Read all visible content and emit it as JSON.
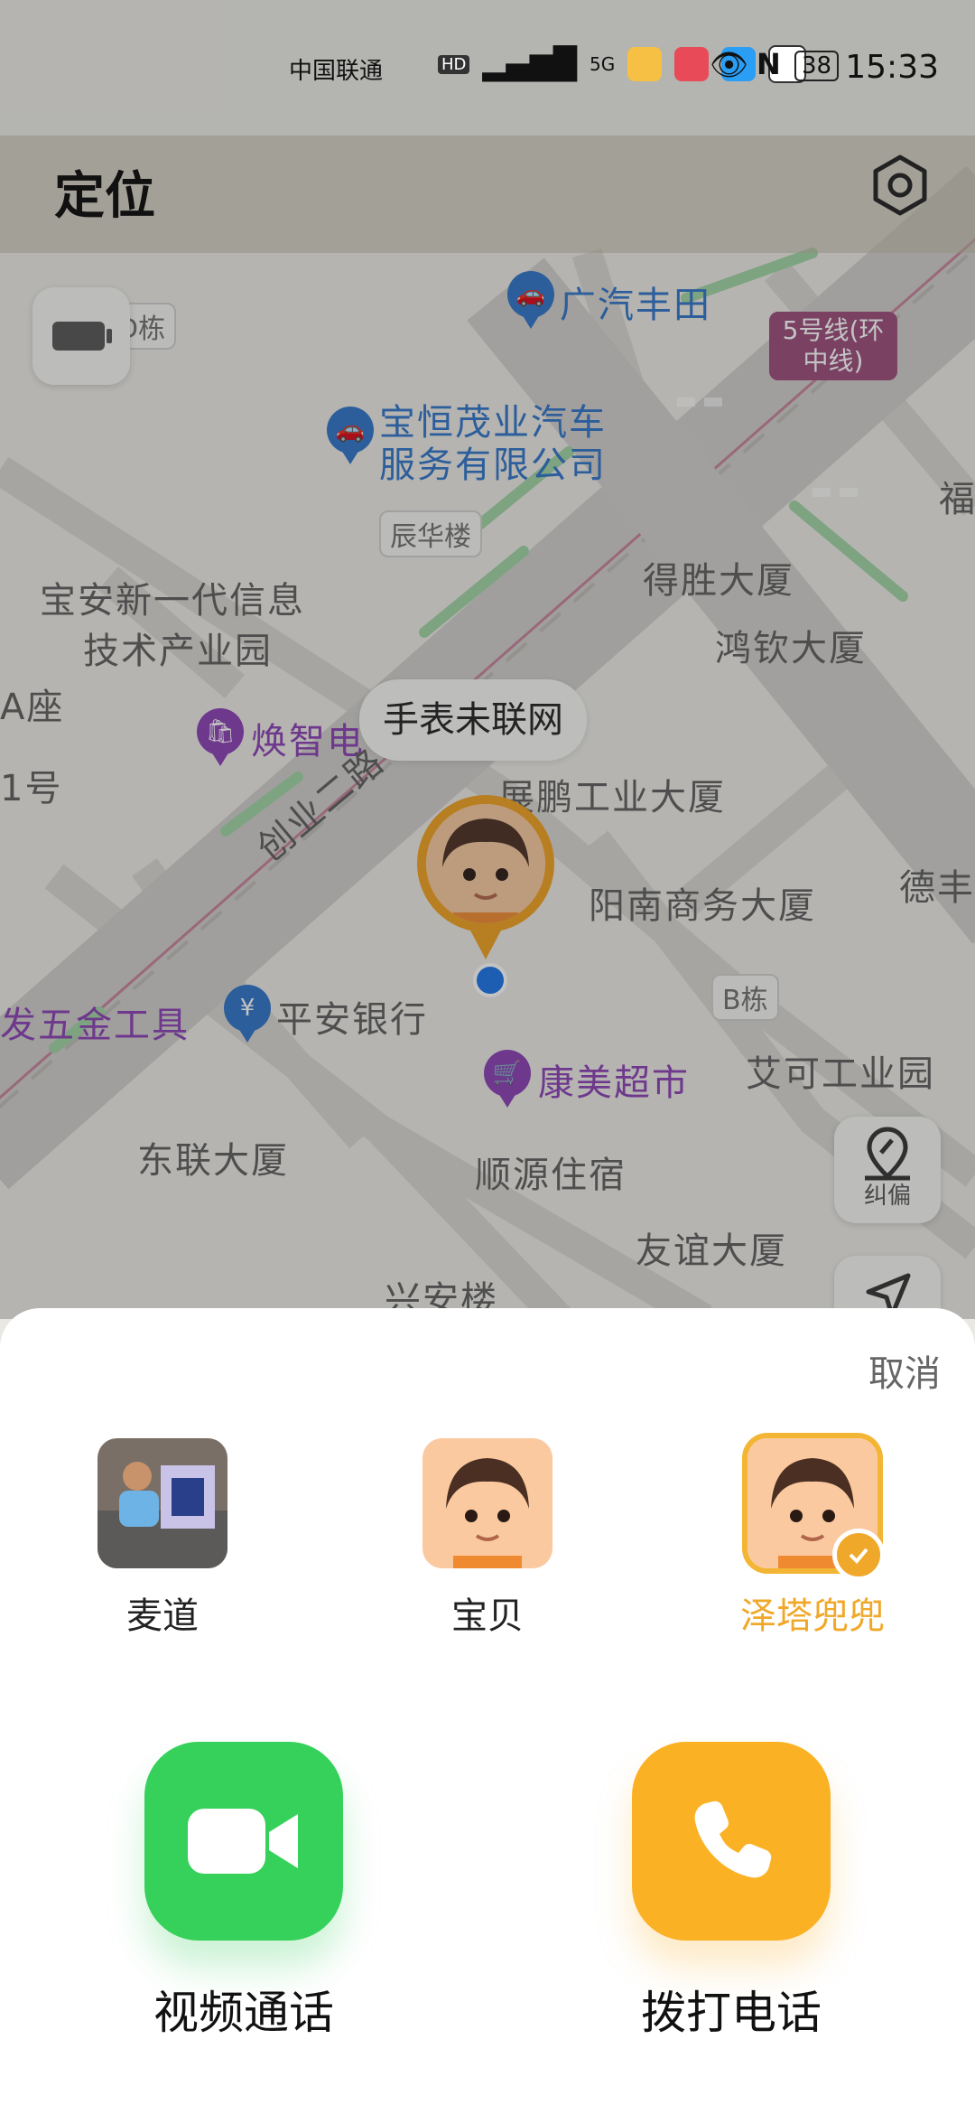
{
  "status_bar": {
    "carrier": "中国联通",
    "hd": "HD",
    "signal": "5G",
    "battery": "38",
    "time": "15:33"
  },
  "header": {
    "title": "定位"
  },
  "map": {
    "labels": {
      "gac_toyota": "广汽丰田",
      "d_building": "D栋",
      "metro_line": "5号线(环中线)",
      "baoheng_line1": "宝恒茂业汽车",
      "baoheng_line2": "服务有限公司",
      "chenhua": "辰华楼",
      "desheng": "得胜大厦",
      "hongqin": "鸿钦大厦",
      "baoan_line1": "宝安新一代信息",
      "baoan_line2": "技术产业园",
      "huanzhi": "焕智电",
      "zhanpeng": "展鹏工业大厦",
      "chuangye_road": "创业二路",
      "yangnan": "阳南商务大厦",
      "deng": "德丰",
      "pingan": "平安银行",
      "hardware": "发五金工具",
      "b_building": "B栋",
      "aike": "艾可工业园",
      "kangmei": "康美超市",
      "donglian": "东联大厦",
      "shunyuan": "顺源住宿",
      "youyi": "友谊大厦",
      "xingan": "兴安楼",
      "fu": "福",
      "a_zuo": "A座",
      "no1": "1号"
    },
    "bubble_text": "手表未联网",
    "correct_label": "纠偏"
  },
  "sheet": {
    "cancel": "取消",
    "members": [
      {
        "name": "麦道",
        "selected": false
      },
      {
        "name": "宝贝",
        "selected": false
      },
      {
        "name": "泽塔兜兜",
        "selected": true
      }
    ],
    "actions": {
      "video": "视频通话",
      "call": "拨打电话"
    }
  }
}
